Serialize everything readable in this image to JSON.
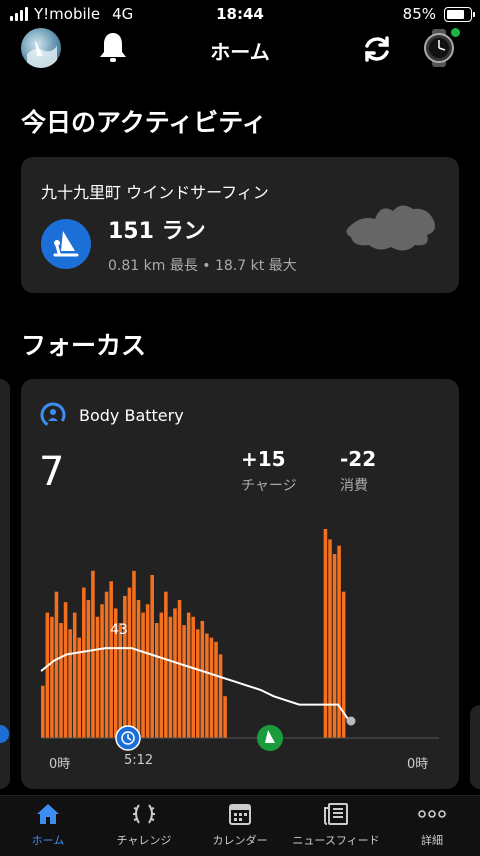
{
  "status_bar": {
    "carrier": "Y!mobile",
    "network": "4G",
    "time": "18:44",
    "battery": "85%",
    "battery_level": 0.85
  },
  "header": {
    "title": "ホーム"
  },
  "today": {
    "section_title": "今日のアクティビティ",
    "activity_name": "九十九里町 ウインドサーフィン",
    "count": "151 ラン",
    "details": "0.81 km 最長 • 18.7 kt 最大"
  },
  "focus": {
    "section_title": "フォーカス",
    "body_battery": {
      "label": "Body Battery",
      "value": "7",
      "charge": {
        "value": "+15",
        "label": "チャージ"
      },
      "drain": {
        "value": "-22",
        "label": "消費"
      },
      "peak_label": "43",
      "x_labels": [
        "0時",
        "5:12",
        "0時"
      ]
    }
  },
  "tabs": [
    {
      "label": "ホーム",
      "icon": "home-icon",
      "active": true
    },
    {
      "label": "チャレンジ",
      "icon": "laurel-icon",
      "active": false
    },
    {
      "label": "カレンダー",
      "icon": "calendar-icon",
      "active": false
    },
    {
      "label": "ニュースフィード",
      "icon": "newsfeed-icon",
      "active": false
    },
    {
      "label": "詳細",
      "icon": "more-icon",
      "active": false
    }
  ],
  "colors": {
    "accent": "#3d8ef0",
    "bar": "#f2701f",
    "battery_line": "#ffffff",
    "activity_blue": "#1c6fd6",
    "activity_green": "#1a9c3d"
  },
  "chart_data": {
    "type": "bar",
    "title": "",
    "ylabel": "",
    "ylim": [
      0,
      100
    ],
    "series": [
      {
        "values": [
          25,
          60,
          58,
          70,
          55,
          65,
          52,
          60,
          48,
          72,
          66,
          80,
          58,
          64,
          70,
          75,
          62,
          55,
          68,
          72,
          80,
          66,
          60,
          64,
          78,
          55,
          60,
          70,
          58,
          62,
          66,
          54,
          60,
          58,
          52,
          56,
          50,
          48,
          46,
          40,
          20,
          0,
          0,
          0,
          0,
          0,
          0,
          0,
          0,
          0,
          0,
          0,
          0,
          0,
          0,
          0,
          0,
          0,
          0,
          0,
          0,
          0,
          100,
          95,
          88,
          92,
          70,
          0
        ]
      }
    ],
    "battery_line": [
      32,
      37,
      40,
      41,
      42,
      43,
      43,
      43,
      41,
      39,
      37,
      35,
      33,
      31,
      29,
      27,
      25,
      23,
      20,
      18,
      16,
      16,
      16,
      16,
      7
    ]
  }
}
